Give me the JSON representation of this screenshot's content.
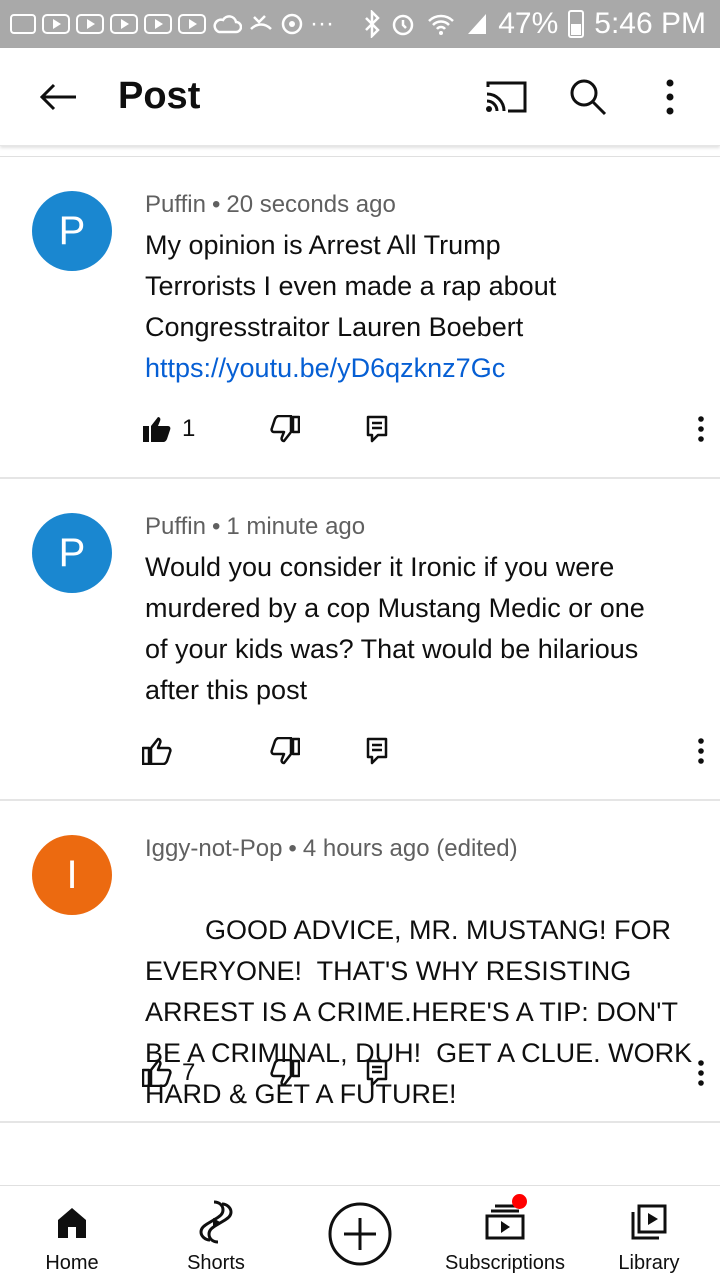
{
  "status_bar": {
    "battery": "47%",
    "time": "5:46 PM",
    "more_dots": "···"
  },
  "header": {
    "title": "Post",
    "icons": [
      "back-arrow-icon",
      "cast-icon",
      "search-icon",
      "more-vert-icon"
    ]
  },
  "comments": [
    {
      "avatar_letter": "P",
      "avatar_color": "#1a87d0",
      "author": "Puffin",
      "time": "20 seconds ago",
      "text_lines": [
        "My opinion is Arrest All Trump",
        "Terrorists I even made a rap about",
        "Congresstraitor Lauren Boebert"
      ],
      "link": "https://youtu.be/yD6qzknz7Gc",
      "likes": "1",
      "liked": true
    },
    {
      "avatar_letter": "P",
      "avatar_color": "#1a87d0",
      "author": "Puffin",
      "time": "1 minute ago",
      "text_lines": [
        "Would you consider it Ironic if you were",
        "murdered by a cop Mustang Medic or one",
        "of your kids was? That would be hilarious",
        "after this post"
      ],
      "likes": "",
      "liked": false
    },
    {
      "avatar_letter": "I",
      "avatar_color": "#ec6a10",
      "author": "Iggy-not-Pop",
      "time": "4 hours ago (edited)",
      "text_lines": [
        "GOOD ADVICE, MR. MUSTANG! FOR",
        "EVERYONE!  THAT'S WHY RESISTING",
        "ARREST IS A CRIME.HERE'S A TIP: DON'T",
        "BE A CRIMINAL, DUH!  GET A CLUE. WORK",
        "HARD & GET A FUTURE!"
      ],
      "likes": "7",
      "liked": false
    }
  ],
  "bottom_nav": {
    "home": "Home",
    "shorts": "Shorts",
    "subscriptions": "Subscriptions",
    "library": "Library"
  },
  "colors": {
    "status_bar": "#a9a9a9",
    "link": "#065fd4",
    "notification_dot": "#ff0000"
  }
}
